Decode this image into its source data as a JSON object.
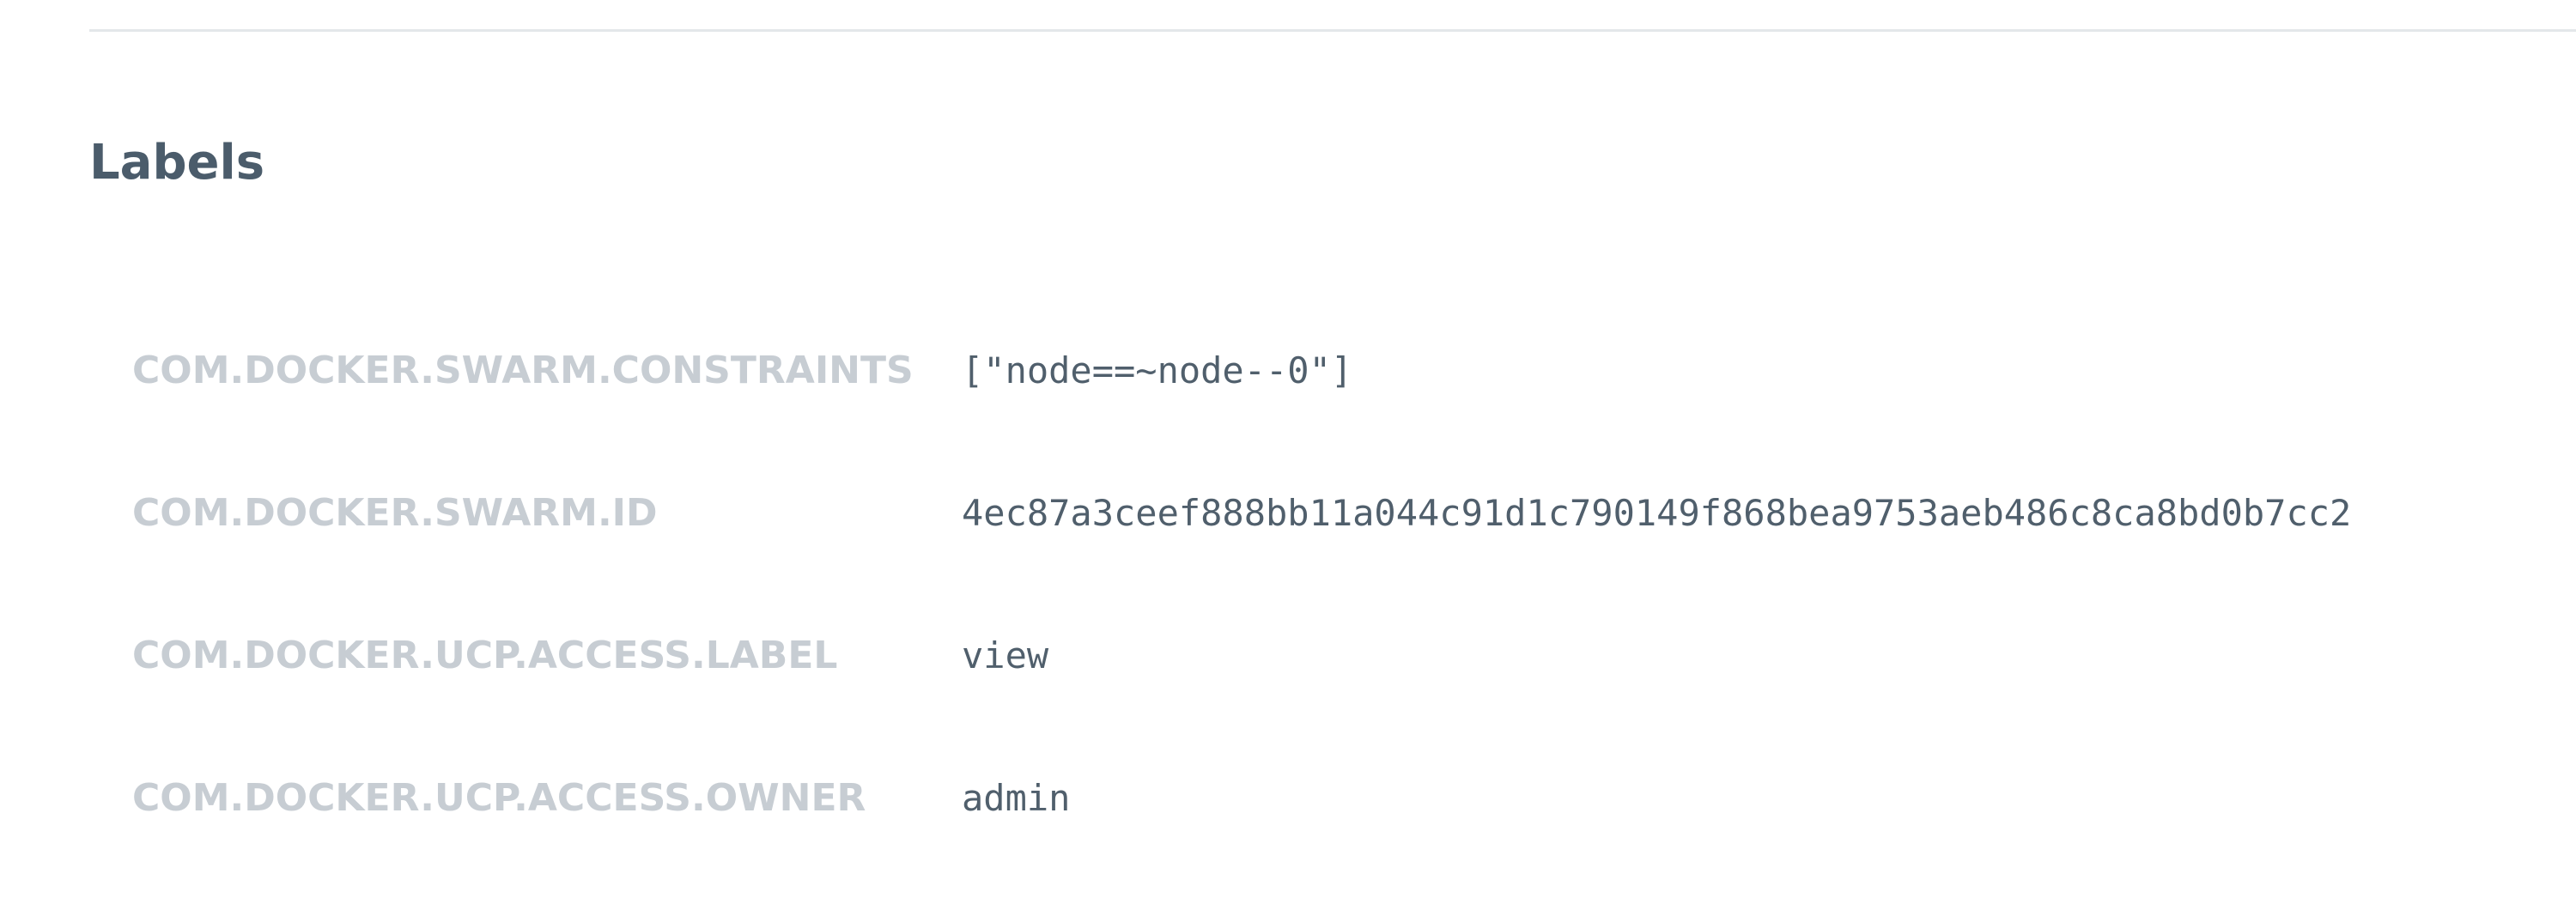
{
  "section": {
    "title": "Labels"
  },
  "labels": [
    {
      "key": "COM.DOCKER.SWARM.CONSTRAINTS",
      "value": "[\"node==~node--0\"]"
    },
    {
      "key": "COM.DOCKER.SWARM.ID",
      "value": "4ec87a3ceef888bb11a044c91d1c790149f868bea9753aeb486c8ca8bd0b7cc2"
    },
    {
      "key": "COM.DOCKER.UCP.ACCESS.LABEL",
      "value": "view"
    },
    {
      "key": "COM.DOCKER.UCP.ACCESS.OWNER",
      "value": "admin"
    }
  ],
  "colors": {
    "divider": "#e3e7ea",
    "title": "#4b5c6b",
    "key": "#c7cdd3",
    "value": "#505f6c"
  }
}
